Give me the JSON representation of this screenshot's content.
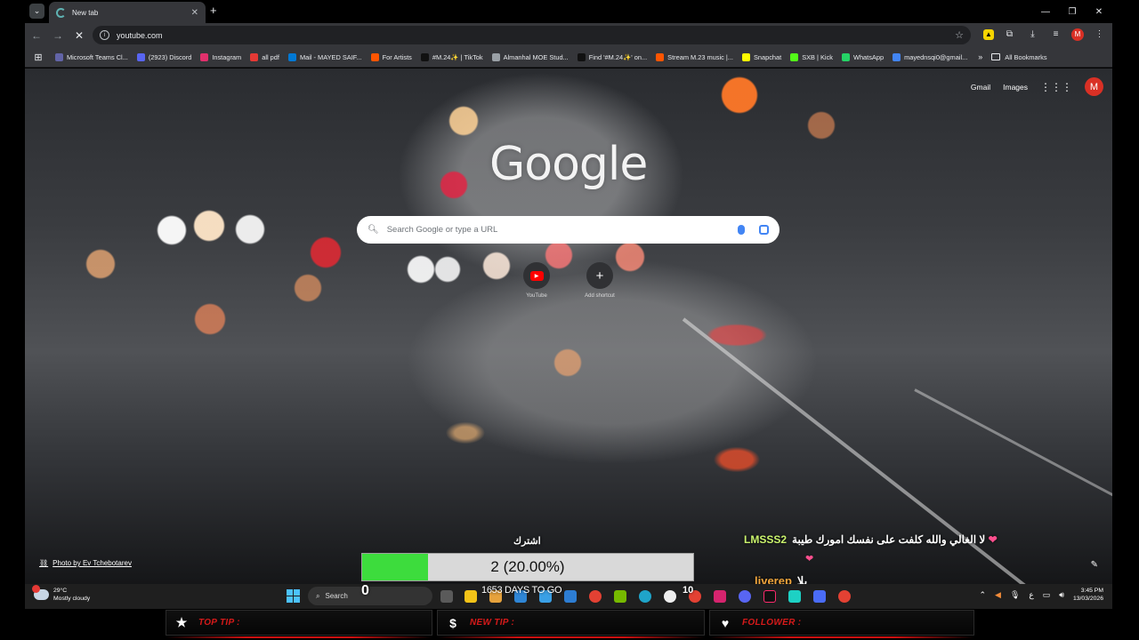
{
  "browser": {
    "tab_title": "New tab",
    "url": "youtube.com",
    "window_controls": [
      "—",
      "❐",
      "✕"
    ]
  },
  "bookmarks": [
    {
      "label": "Microsoft Teams Cl...",
      "color": "#6264a7"
    },
    {
      "label": "(2923) Discord",
      "color": "#5865f2"
    },
    {
      "label": "Instagram",
      "color": "#e1306c"
    },
    {
      "label": "all pdf",
      "color": "#e53935"
    },
    {
      "label": "Mail - MAYED SAIF...",
      "color": "#0078d4"
    },
    {
      "label": "For Artists",
      "color": "#ff5500"
    },
    {
      "label": "#M.24✨ | TikTok",
      "color": "#111111"
    },
    {
      "label": "Almanhal MOE Stud...",
      "color": "#9aa0a6"
    },
    {
      "label": "Find '#M.24✨' on...",
      "color": "#111111"
    },
    {
      "label": "Stream M.23 music |...",
      "color": "#ff5500"
    },
    {
      "label": "Snapchat",
      "color": "#fffc00"
    },
    {
      "label": "SXB | Kick",
      "color": "#53fc18"
    },
    {
      "label": "WhatsApp",
      "color": "#25d366"
    },
    {
      "label": "mayednsqi0@gmail...",
      "color": "#4285f4"
    }
  ],
  "bookmarks_more": "»",
  "all_bookmarks": "All Bookmarks",
  "newtab": {
    "gmail": "Gmail",
    "images": "Images",
    "avatar_letter": "M",
    "logo": "Google",
    "search_placeholder": "Search Google or type a URL",
    "shortcuts": [
      {
        "label": "YouTube"
      },
      {
        "label": "Add shortcut"
      }
    ],
    "photo_credit": "Photo by Ev Tchebotarev"
  },
  "overlay": {
    "subscribe_label": "اشترك",
    "goal_text": "2 (20.00%)",
    "goal_fraction": 0.2,
    "counter_left": "0",
    "days_to_go": "1653 DAYS TO GO",
    "counter_right": "10",
    "chat": [
      {
        "user": "LMSSS2",
        "message": "لا الغالي والله كلفت على نفسك امورك طيبة"
      },
      {
        "user": "liverep",
        "message": "يلا"
      }
    ]
  },
  "taskbar": {
    "temp": "29°C",
    "weather": "Mostly cloudy",
    "search": "Search",
    "time": "3:45 PM",
    "date": "13/03/2026",
    "lang": "ع"
  },
  "stream_bar": {
    "top_tip": "TOP TIP :",
    "new_tip": "NEW TIP :",
    "follower": "FOLLOWER :"
  }
}
